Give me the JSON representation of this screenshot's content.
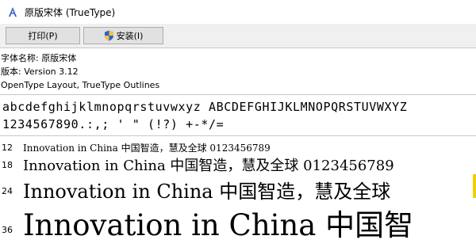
{
  "window": {
    "title": "原版宋体 (TrueType)",
    "icon": "font-a-icon"
  },
  "toolbar": {
    "print_label": "打印(P)",
    "install_label": "安装(I)",
    "install_icon": "shield-icon"
  },
  "info": {
    "font_name": "字体名称: 原版宋体",
    "version": "版本: Version 3.12",
    "outline": "OpenType Layout, TrueType Outlines"
  },
  "charset": {
    "line1": "abcdefghijklmnopqrstuvwxyz ABCDEFGHIJKLMNOPQRSTUVWXYZ",
    "line2": "1234567890.:,; ' \" (!?) +-*/="
  },
  "samples": [
    {
      "size": "12",
      "text": "Innovation in China 中国智造，慧及全球 0123456789"
    },
    {
      "size": "18",
      "text": "Innovation in China 中国智造，慧及全球 0123456789"
    },
    {
      "size": "24",
      "text": "Innovation in China 中国智造，慧及全球"
    },
    {
      "size": "36",
      "text": "Innovation in China 中国智"
    }
  ],
  "colors": {
    "titlebar": "#ffffff",
    "toolbar": "#f0f0f0",
    "button": "#e1e1e1",
    "button_border": "#adadad"
  }
}
